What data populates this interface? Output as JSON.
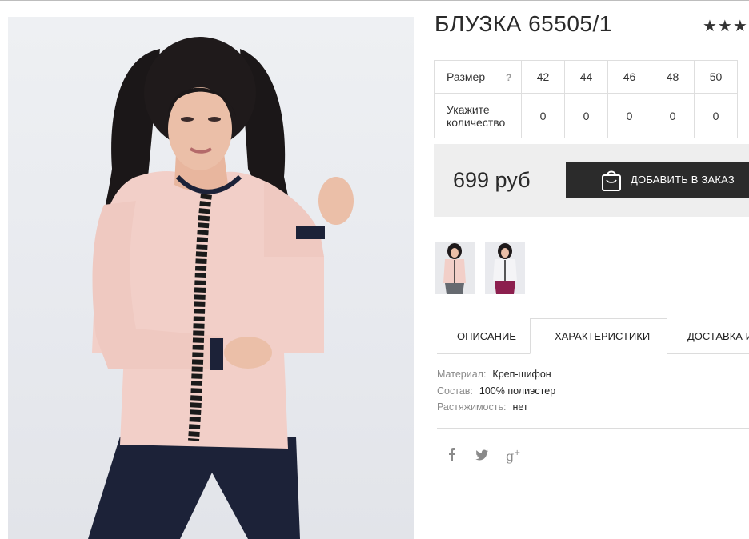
{
  "product": {
    "title": "БЛУЗКА 65505/1",
    "rating_stars": "★★★"
  },
  "size_table": {
    "size_label": "Размер",
    "help_mark": "?",
    "sizes": [
      "42",
      "44",
      "46",
      "48",
      "50"
    ],
    "quantity_label_line1": "Укажите",
    "quantity_label_line2": "количество",
    "quantities": [
      "0",
      "0",
      "0",
      "0",
      "0"
    ]
  },
  "purchase": {
    "price": "699 руб",
    "add_button_label": "ДОБАВИТЬ В ЗАКАЗ"
  },
  "tabs": {
    "description": "ОПИСАНИЕ",
    "characteristics": "ХАРАКТЕРИСТИКИ",
    "delivery": "ДОСТАВКА И"
  },
  "characteristics": [
    {
      "key": "Материал:",
      "value": "Креп-шифон"
    },
    {
      "key": "Состав:",
      "value": "100% полиэстер"
    },
    {
      "key": "Растяжимость:",
      "value": "нет"
    }
  ],
  "social": [
    "facebook-icon",
    "twitter-icon",
    "google-plus-icon"
  ],
  "colors": {
    "button_bg": "#2b2b2b",
    "price_box_bg": "#eeeeee",
    "blouse_pink": "#f2cfc8",
    "trousers_navy": "#1c2238"
  }
}
